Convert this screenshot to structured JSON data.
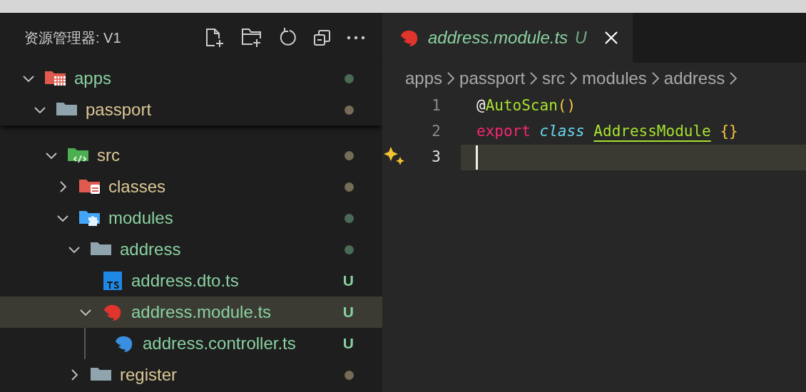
{
  "explorer": {
    "title": "资源管理器: V1",
    "tree": [
      {
        "label": "apps",
        "kind": "folder-apps",
        "expanded": true,
        "selected": false,
        "untracked": true,
        "children": [
          {
            "label": "passport",
            "kind": "folder",
            "expanded": true,
            "selected": false,
            "untracked": false,
            "children": [
              {
                "label": "src",
                "kind": "folder-src",
                "expanded": true,
                "selected": false,
                "untracked": false,
                "children": [
                  {
                    "label": "classes",
                    "kind": "folder-classes",
                    "expanded": false,
                    "selected": false,
                    "untracked": false
                  },
                  {
                    "label": "modules",
                    "kind": "folder-modules",
                    "expanded": true,
                    "selected": false,
                    "untracked": true,
                    "children": [
                      {
                        "label": "address",
                        "kind": "folder",
                        "expanded": true,
                        "selected": false,
                        "untracked": true,
                        "children": [
                          {
                            "label": "address.dto.ts",
                            "kind": "ts",
                            "selected": false,
                            "untracked": true,
                            "badge": "U"
                          },
                          {
                            "label": "address.module.ts",
                            "kind": "nest-module",
                            "expanded": true,
                            "selected": true,
                            "untracked": true,
                            "badge": "U",
                            "children": [
                              {
                                "label": "address.controller.ts",
                                "kind": "nest-controller",
                                "selected": false,
                                "untracked": true,
                                "badge": "U"
                              }
                            ]
                          }
                        ]
                      },
                      {
                        "label": "register",
                        "kind": "folder",
                        "expanded": false,
                        "selected": false,
                        "untracked": false
                      }
                    ]
                  }
                ]
              }
            ]
          }
        ]
      }
    ]
  },
  "tabs": [
    {
      "label": "address.module.ts",
      "badge": "U",
      "kind": "nest-module",
      "selected": true,
      "preview": true
    }
  ],
  "breadcrumbs": [
    "apps",
    "passport",
    "src",
    "modules",
    "address"
  ],
  "editor": {
    "lines": [
      {
        "number": "1",
        "current": false,
        "sparkle": false,
        "tokens": [
          {
            "text": "@",
            "kind": "punct",
            "space_before": false
          },
          {
            "text": "AutoScan",
            "kind": "function",
            "space_before": false
          },
          {
            "text": "()",
            "kind": "bracket",
            "space_before": false
          }
        ]
      },
      {
        "number": "2",
        "current": false,
        "sparkle": false,
        "tokens": [
          {
            "text": "export",
            "kind": "keyword",
            "space_before": false
          },
          {
            "text": "class",
            "kind": "storage",
            "space_before": true
          },
          {
            "text": "AddressModule",
            "kind": "class-name",
            "underline": true,
            "space_before": true
          },
          {
            "text": "{}",
            "kind": "bracket",
            "space_before": true
          }
        ]
      },
      {
        "number": "3",
        "current": true,
        "sparkle": true
      }
    ]
  }
}
